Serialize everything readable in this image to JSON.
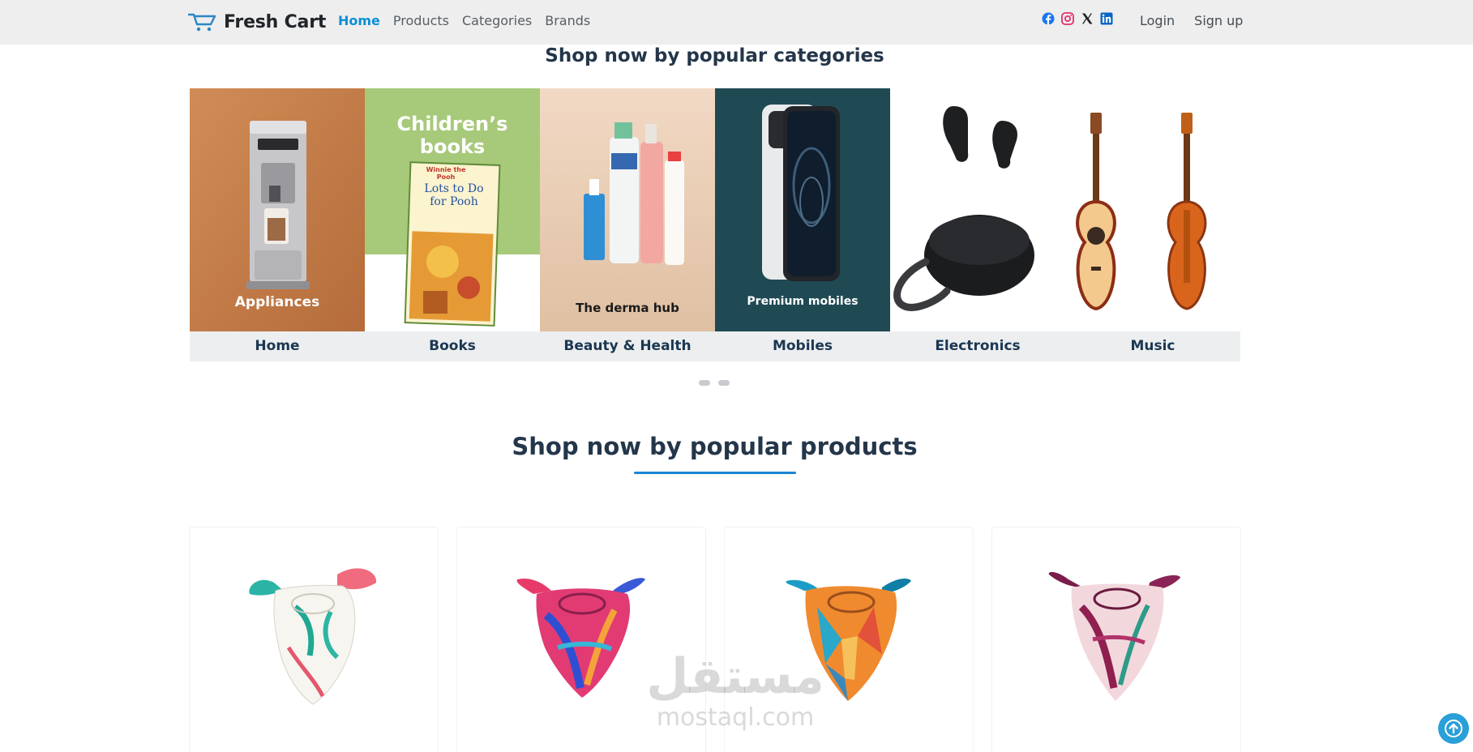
{
  "navbar": {
    "brand": "Fresh Cart",
    "links": [
      {
        "label": "Home",
        "active": true
      },
      {
        "label": "Products",
        "active": false
      },
      {
        "label": "Categories",
        "active": false
      },
      {
        "label": "Brands",
        "active": false
      }
    ],
    "socials": [
      "facebook-icon",
      "instagram-icon",
      "x-twitter-icon",
      "linkedin-icon"
    ],
    "auth": {
      "login": "Login",
      "signup": "Sign up"
    }
  },
  "categories": {
    "title": "Shop now by popular categories",
    "items": [
      {
        "label": "Home",
        "image_text": "Appliances"
      },
      {
        "label": "Books",
        "image_text": "Children’s books"
      },
      {
        "label": "Beauty & Health",
        "image_text": "The derma hub"
      },
      {
        "label": "Mobiles",
        "image_text": "Premium mobiles"
      },
      {
        "label": "Electronics",
        "image_text": ""
      },
      {
        "label": "Music",
        "image_text": ""
      }
    ],
    "book_title": "Lots to Do for Pooh",
    "book_brand": "Winnie the Pooh",
    "carousel_pages": 2
  },
  "products": {
    "title": "Shop now by popular products",
    "items": [
      {
        "name": "scarf-teal-floral"
      },
      {
        "name": "scarf-multicolor-pink"
      },
      {
        "name": "scarf-orange-geometric"
      },
      {
        "name": "scarf-burgundy-floral"
      }
    ]
  },
  "watermark": {
    "arabic": "مستقل",
    "latin": "mostaql.com"
  },
  "colors": {
    "accent": "#0d8fd6",
    "nav_bg": "#eeeeee",
    "title": "#24364a",
    "category_label": "#1b3752",
    "back_to_top": "#2a9fd8"
  }
}
